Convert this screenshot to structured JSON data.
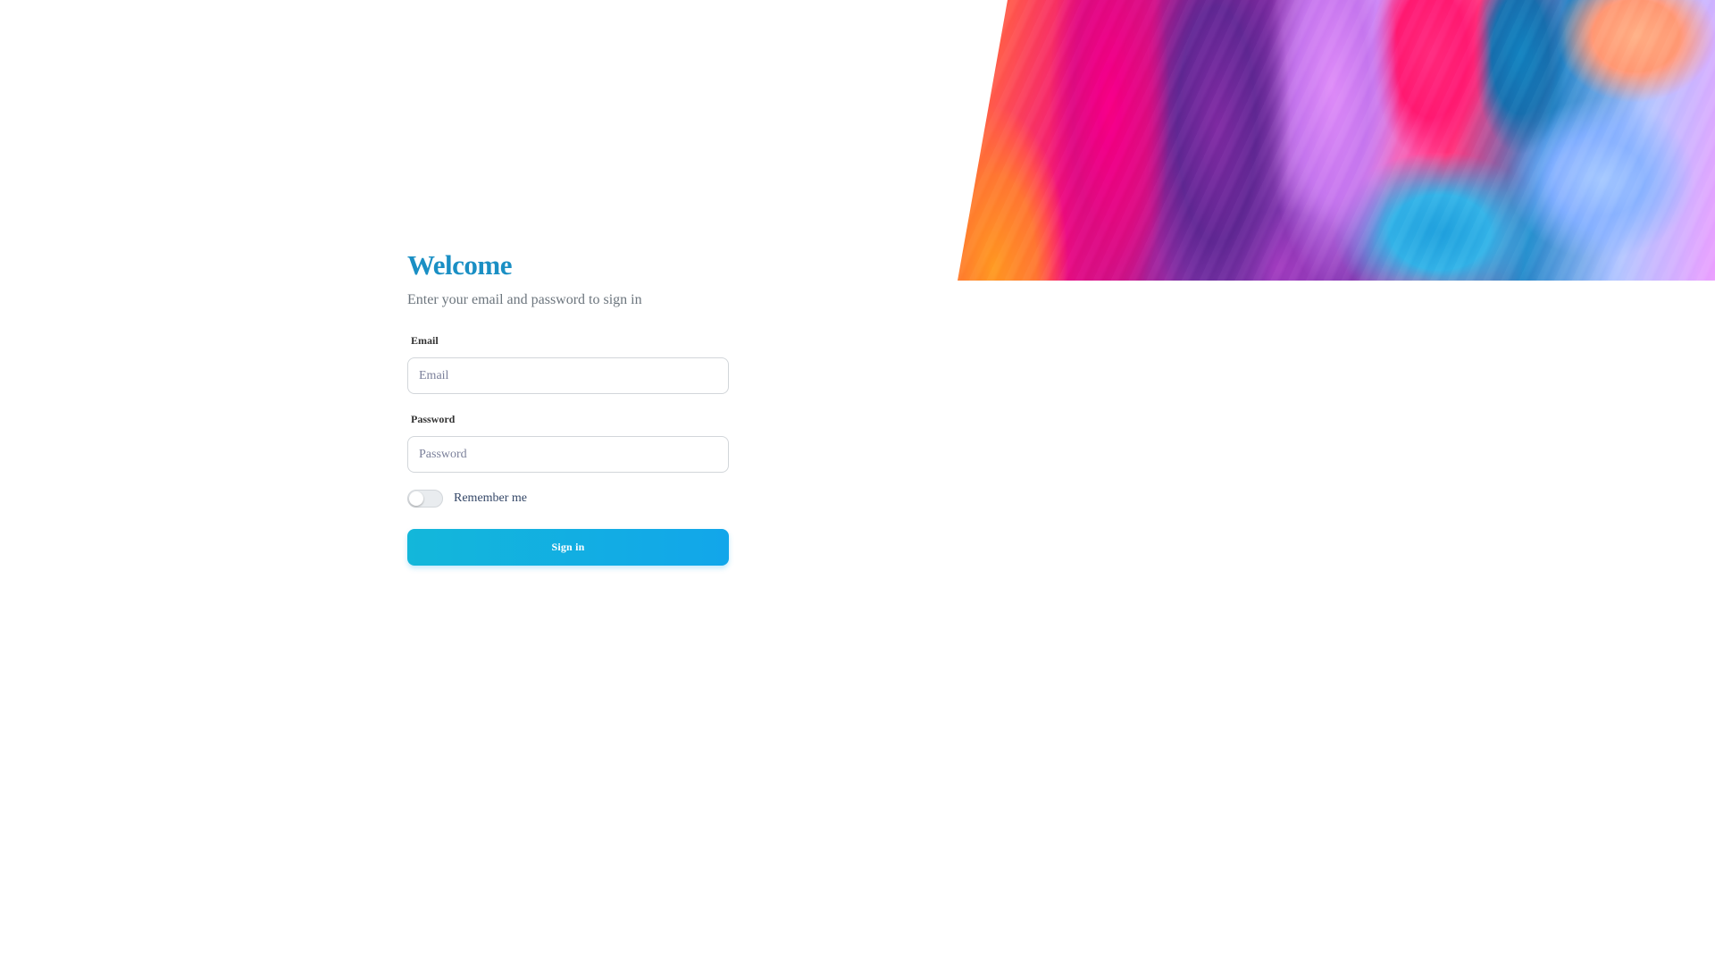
{
  "hero": {
    "image_name": "abstract-gradient-image"
  },
  "form": {
    "title": "Welcome",
    "subtitle": "Enter your email and password to sign in",
    "email_label": "Email",
    "email_placeholder": "Email",
    "email_value": "",
    "password_label": "Password",
    "password_placeholder": "Password",
    "password_value": "",
    "remember_label": "Remember me",
    "remember_checked": false,
    "submit_label": "Sign in"
  },
  "colors": {
    "title": "#1a8fc4",
    "button_start": "#13b7da",
    "button_end": "#12a6ea",
    "subtitle": "#6c757d"
  }
}
